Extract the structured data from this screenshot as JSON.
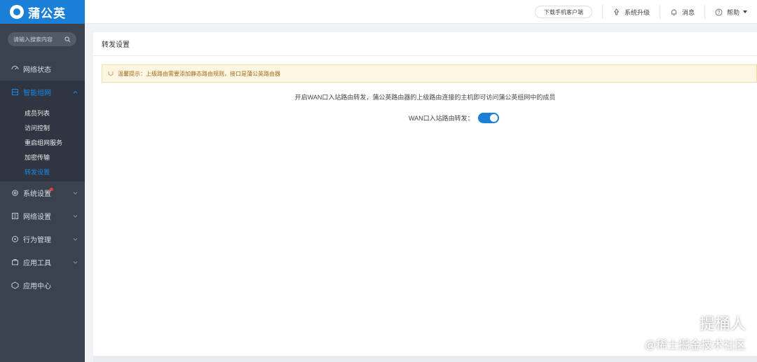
{
  "app": {
    "logo_text": "蒲公英"
  },
  "search": {
    "placeholder": "请输入搜索内容"
  },
  "sidebar": {
    "items": [
      {
        "label": "网络状态",
        "icon": "network-status-icon"
      },
      {
        "label": "智能组网",
        "icon": "smart-network-icon",
        "active": true
      },
      {
        "label": "系统设置",
        "icon": "gear-icon",
        "badge_dot": true
      },
      {
        "label": "网络设置",
        "icon": "network-settings-icon"
      },
      {
        "label": "行为管理",
        "icon": "behavior-icon"
      },
      {
        "label": "应用工具",
        "icon": "toolbox-icon"
      },
      {
        "label": "应用中心",
        "icon": "app-center-icon"
      }
    ],
    "sub_items": [
      {
        "label": "成员列表"
      },
      {
        "label": "访问控制"
      },
      {
        "label": "重启组网服务"
      },
      {
        "label": "加密传输"
      },
      {
        "label": "转发设置",
        "active": true
      }
    ]
  },
  "topbar": {
    "download_label": "下载手机客户端",
    "upgrade_label": "系统升级",
    "messages_label": "消息",
    "help_label": "帮助"
  },
  "main": {
    "title": "转发设置",
    "notice": "温馨提示：上级路由需要添加静态路由规则，接口是蒲公英路由器",
    "description": "开启WAN口入站路由转发，蒲公英路由器的上级路由连接的主机即可访问蒲公英组网中的成员",
    "toggle_label": "WAN口入站路由转发：",
    "toggle_on": true
  },
  "watermark": {
    "line1": "提桶人",
    "line2": "@稀土掘金技术社区"
  },
  "colors": {
    "brand": "#1a7fd6",
    "sidebar_bg": "#3a4250",
    "sidebar_active_bg": "#2f3541",
    "notice_bg": "#fdf6e3",
    "notice_text": "#a36a1a"
  }
}
